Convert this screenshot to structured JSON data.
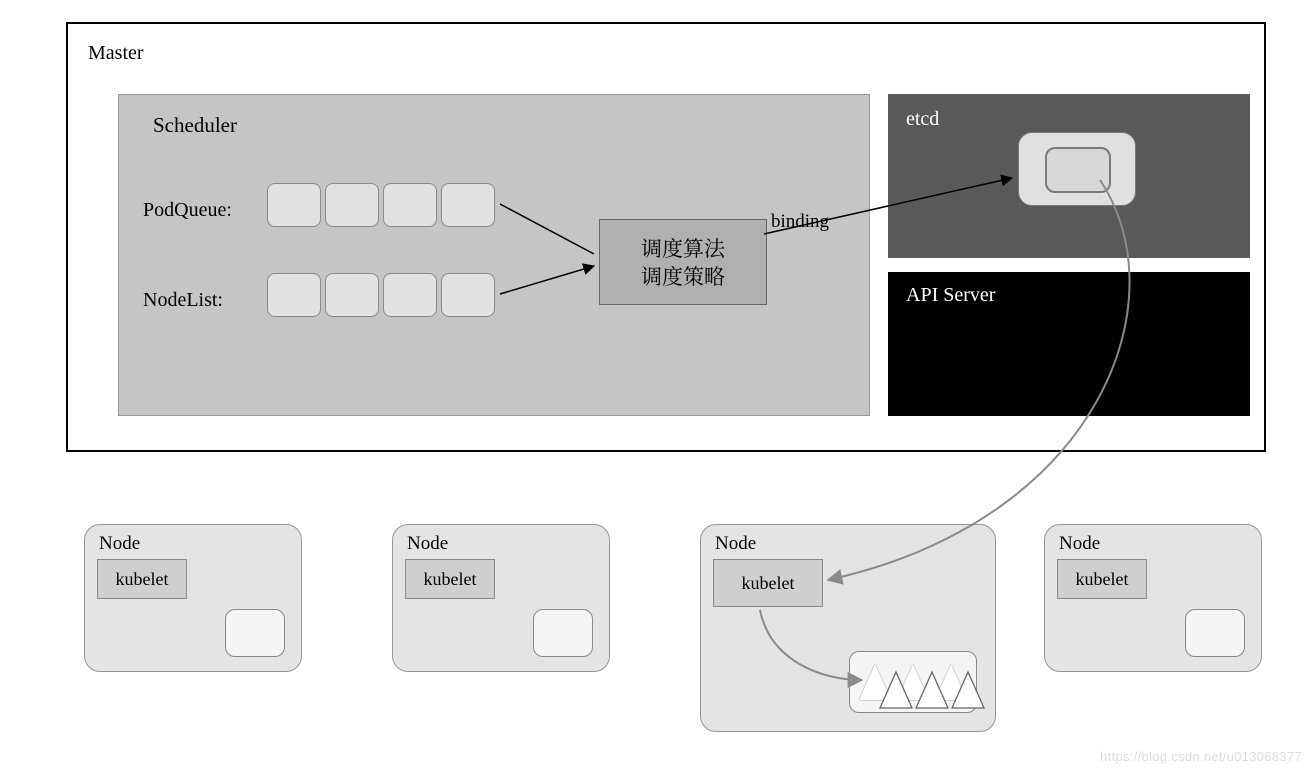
{
  "master": {
    "label": "Master",
    "scheduler": {
      "label": "Scheduler",
      "podqueue_label": "PodQueue:",
      "nodelist_label": "NodeList:",
      "algo_line1": "调度算法",
      "algo_line2": "调度策略",
      "binding_label": "binding"
    },
    "etcd": {
      "label": "etcd"
    },
    "api_server": {
      "label": "API Server"
    }
  },
  "nodes": {
    "label": "Node",
    "kubelet_label": "kubelet"
  },
  "watermark": "https://blog.csdn.net/u013068377"
}
